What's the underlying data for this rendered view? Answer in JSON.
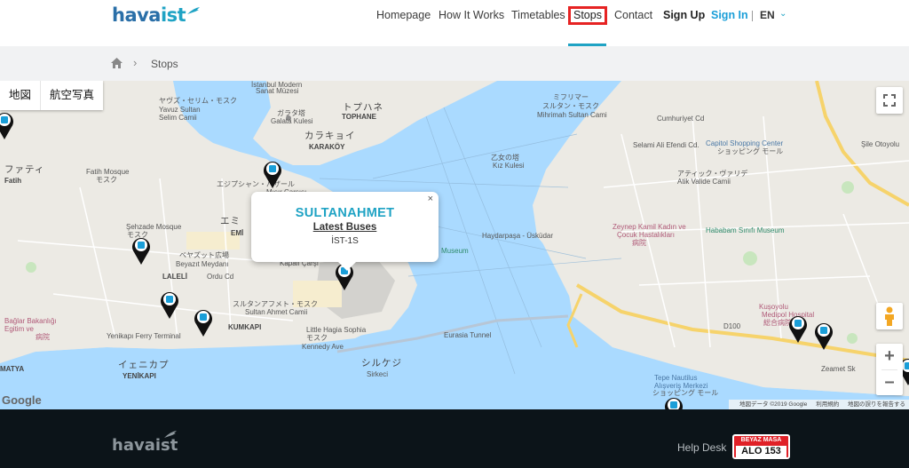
{
  "brand": {
    "logo_part1": "hava",
    "logo_part2": "ist"
  },
  "nav": {
    "items": [
      "Homepage",
      "How It Works",
      "Timetables",
      "Stops",
      "Contact"
    ],
    "sign_up": "Sign Up",
    "sign_in": "Sign In",
    "language": "EN",
    "active": "Stops"
  },
  "breadcrumb": {
    "home_icon": "home-icon",
    "current": "Stops"
  },
  "map": {
    "map_type_options": [
      "地図",
      "航空写真"
    ],
    "selected_map_type": "地図",
    "google_brand": "Google",
    "attribution": [
      "地図データ ©2019 Google",
      "利用規約",
      "地図の誤りを報告する"
    ],
    "popup": {
      "title": "SULTANAHMET",
      "subtitle": "Latest Buses",
      "line": "İST-1S",
      "close": "×"
    },
    "place_labels": [
      "İstanbul Modern",
      "Sanat Müzesi",
      "ヤヴズ・セリム・モスク",
      "Yavuz Sultan",
      "Selim Camii",
      "ガラタ塔",
      "Galata Kulesi",
      "トプハネ",
      "TOPHANE",
      "カラキョイ",
      "KARAKÖY",
      "ミフリマー",
      "スルタン・モスク",
      "Mihrimah Sultan Cami",
      "乙女の塔",
      "Kız Kulesi",
      "ファティ",
      "Fatih",
      "Fatih Mosque",
      "モスク",
      "エジプシャン・バザール",
      "Mısır Çarşısı",
      "Şehzade Mosque",
      "モスク",
      "エミ",
      "EMİ",
      "ベヤズット広場",
      "Beyazıt Meydanı",
      "LALELİ",
      "Ordu Cd",
      "Kapalı Çarşı",
      "スルタンアフメト・モスク",
      "Sultan Ahmet Camii",
      "Little Hagia Sophia",
      "モスク",
      "KUMKAPI",
      "Yenikapı Ferry Terminal",
      "イェニカプ",
      "YENİKAPI",
      "シルケジ",
      "Sirkeci",
      "MATYA",
      "Museum",
      "Capitol Shopping Center",
      "ショッピング モール",
      "アティック・ヴァリデ",
      "Atik Valide Camii",
      "Zeynep Kamil Kadın ve",
      "Çocuk Hastalıkları",
      "病院",
      "Hababam Sınıfı Museum",
      "Kuşoyolu",
      "Medipol Hospital",
      "総合病院",
      "Tepe Nautilus",
      "Alışveriş Merkezi",
      "ショッピング モール",
      "Şile Otoyolu",
      "Eurasia Tunnel",
      "Kennedy Ave",
      "Bağlar Bakanlığı",
      "Egitim ve",
      "病院",
      "Selami Ali Efendi Cd.",
      "Cumhuriyet Cd",
      "Zeamet Sk",
      "D100",
      "Haydarpaşa - Üsküdar"
    ]
  },
  "footer": {
    "logo_part1": "hava",
    "logo_part2": "ist",
    "help_desk": "Help Desk",
    "alo_top": "BEYAZ MASA",
    "alo_bottom": "ALO 153"
  },
  "colors": {
    "brand_blue": "#2a6fa8",
    "accent_teal": "#1fa3c4",
    "active_outline": "#e62323",
    "water": "#aadaff",
    "footer_bg": "#0c1419"
  }
}
